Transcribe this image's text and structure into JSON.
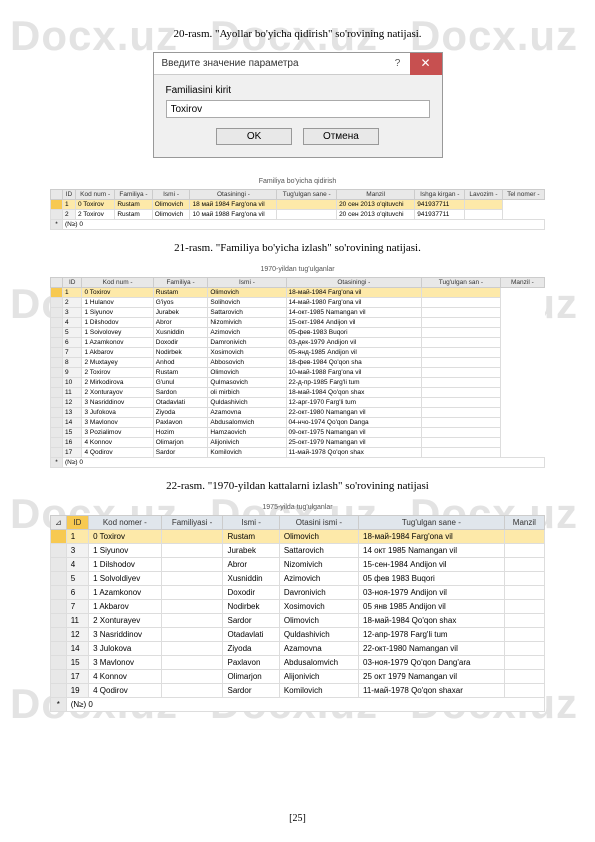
{
  "watermark": "Docx.uz",
  "caption1": "20-rasm. \"Ayollar bo'yicha qidirish\" so'rovining natijasi.",
  "caption2": "21-rasm. \"Familiya bo'yicha izlash\" so'rovining natijasi.",
  "caption3": "22-rasm. \"1970-yildan kattalarni izlash\" so'rovining natijasi",
  "dialog": {
    "title": "Введите значение параметра",
    "label": "Familiasini kirit",
    "value": "Toxirov",
    "ok": "OK",
    "cancel": "Отмена"
  },
  "table1": {
    "title": "Familiya bo'yicha qidirish",
    "headers": [
      "ID",
      "Kod num -",
      "Familiya -",
      "Ismi -",
      "Otasiningi -",
      "Tug'ulgan sane -",
      "Manzil",
      "Ishga kirgan -",
      "Lavozim -",
      "Tel nomer -"
    ],
    "rows": [
      [
        "1",
        "0 Toxirov",
        "Rustam",
        "Olimovich",
        "18 май 1984 Farg'ona vil",
        "",
        "20 сен 2013 o'qituvchi",
        "941937711",
        ""
      ],
      [
        "2",
        "2 Toxirov",
        "Rustam",
        "Olimovich",
        "10 май 1988 Farg'ona vil",
        "",
        "20 сен 2013 o'qituvchi",
        "941937711",
        ""
      ]
    ],
    "footer": "(N≥)"
  },
  "table2": {
    "title": "1970-yildan tug'ulganlar",
    "headers": [
      "ID",
      "Kod num -",
      "Familiya -",
      "Ismi -",
      "Otasiningi -",
      "Tug'ulgan san -",
      "Manzil -"
    ],
    "rows": [
      [
        "1",
        "0 Toxirov",
        "Rustam",
        "Olimovich",
        "18-май-1984 Farg'ona vil",
        ""
      ],
      [
        "2",
        "1 Hulanov",
        "G'iyos",
        "Solihovich",
        "14-май-1980 Farg'ona vil",
        ""
      ],
      [
        "3",
        "1 Siyunov",
        "Jurabek",
        "Sattarovich",
        "14-окт-1985 Namangan vil",
        ""
      ],
      [
        "4",
        "1 Dilshodov",
        "Abror",
        "Nizomivich",
        "15-окт-1984 Andijon vil",
        ""
      ],
      [
        "5",
        "1 Soivolovey",
        "Xusniddin",
        "Azimovich",
        "05-фев-1983 Buqori",
        ""
      ],
      [
        "6",
        "1 Azamkonov",
        "Doxodir",
        "Damronivich",
        "03-дек-1979 Andijon vil",
        ""
      ],
      [
        "7",
        "1 Akbarov",
        "Nodirbek",
        "Xosimovich",
        "05-янд-1985 Andijon vil",
        ""
      ],
      [
        "8",
        "2 Muxtayey",
        "Anhod",
        "Abbosovich",
        "18-фев-1984 Qo'qon sha",
        ""
      ],
      [
        "9",
        "2 Toxirov",
        "Rustam",
        "Olimovich",
        "10-май-1988 Farg'ona vil",
        ""
      ],
      [
        "10",
        "2 Mirkodirova",
        "G'unul",
        "Qulmasovich",
        "22-д-пр-1985 Farg'li tum",
        ""
      ],
      [
        "11",
        "2 Xonturayov",
        "Sardon",
        "oli mirbich",
        "18-май-1984 Qo'qon shax",
        ""
      ],
      [
        "12",
        "3 Nasriddinov",
        "Otadavlati",
        "Quldashivich",
        "12-арг-1970 Farg'li tum",
        ""
      ],
      [
        "13",
        "3 Jufokova",
        "Ziyoda",
        "Azamovna",
        "22-окт-1980 Namangan vil",
        ""
      ],
      [
        "14",
        "3 Mavlonov",
        "Paxlavon",
        "Abdusalomvich",
        "04-нчо-1974 Qo'qon Danga",
        ""
      ],
      [
        "15",
        "3 Pozialimov",
        "Hozim",
        "Hamzaovich",
        "09-окт-1975 Namangan vil",
        ""
      ],
      [
        "16",
        "4 Konnov",
        "Olimarjon",
        "Alijonivich",
        "25-окт-1979 Namangan vil",
        ""
      ],
      [
        "17",
        "4 Qodirov",
        "Sardor",
        "Komilovich",
        "11-май-1978 Qo'qon shax",
        ""
      ]
    ],
    "footer": "(N≥)"
  },
  "table3": {
    "title": "1975-yilda tug'ulganlar",
    "headers": [
      "ID",
      "Kod nomer -",
      "Familiyasi -",
      "Ismi -",
      "Otasini ismi -",
      "Tug'ulgan sane -",
      "Manzil"
    ],
    "rows": [
      [
        "1",
        "0 Toxirov",
        "",
        "Rustam",
        "Olimovich",
        "18-май-1984 Farg'ona vil",
        ""
      ],
      [
        "3",
        "1 Siyunov",
        "",
        "Jurabek",
        "Sattarovich",
        "14 окт 1985 Namangan vil",
        ""
      ],
      [
        "4",
        "1 Dilshodov",
        "",
        "Abror",
        "Nizomivich",
        "15-сен-1984 Andijon vil",
        ""
      ],
      [
        "5",
        "1 Solvoldiyev",
        "",
        "Xusniddin",
        "Azimovich",
        "05 фев 1983 Buqori",
        ""
      ],
      [
        "6",
        "1 Azamkonov",
        "",
        "Doxodir",
        "Davronivich",
        "03-ноя-1979 Andijon vil",
        ""
      ],
      [
        "7",
        "1 Akbarov",
        "",
        "Nodirbek",
        "Xosimovich",
        "05 янв 1985 Andijon vil",
        ""
      ],
      [
        "11",
        "2 Xonturayev",
        "",
        "Sardor",
        "Olimovich",
        "18-май-1984 Qo'qon shax",
        ""
      ],
      [
        "12",
        "3 Nasriddinov",
        "",
        "Otadavlati",
        "Quldashivich",
        "12-апр-1978 Farg'li tum",
        ""
      ],
      [
        "14",
        "3 Julokova",
        "",
        "Ziyoda",
        "Azamovna",
        "22-окт-1980 Namangan vil",
        ""
      ],
      [
        "15",
        "3 Mavlonov",
        "",
        "Paxlavon",
        "Abdusalomvich",
        "03-ноя-1979 Qo'qon Dang'ara",
        ""
      ],
      [
        "17",
        "4 Konnov",
        "",
        "Olimarjon",
        "Alijonivich",
        "25 окт 1979 Namangan vil",
        ""
      ],
      [
        "19",
        "4 Qodirov",
        "",
        "Sardor",
        "Komilovich",
        "11-май-1978 Qo'qon shaxar",
        ""
      ]
    ],
    "footer": "(N≥)"
  },
  "page_footer": "[25]"
}
